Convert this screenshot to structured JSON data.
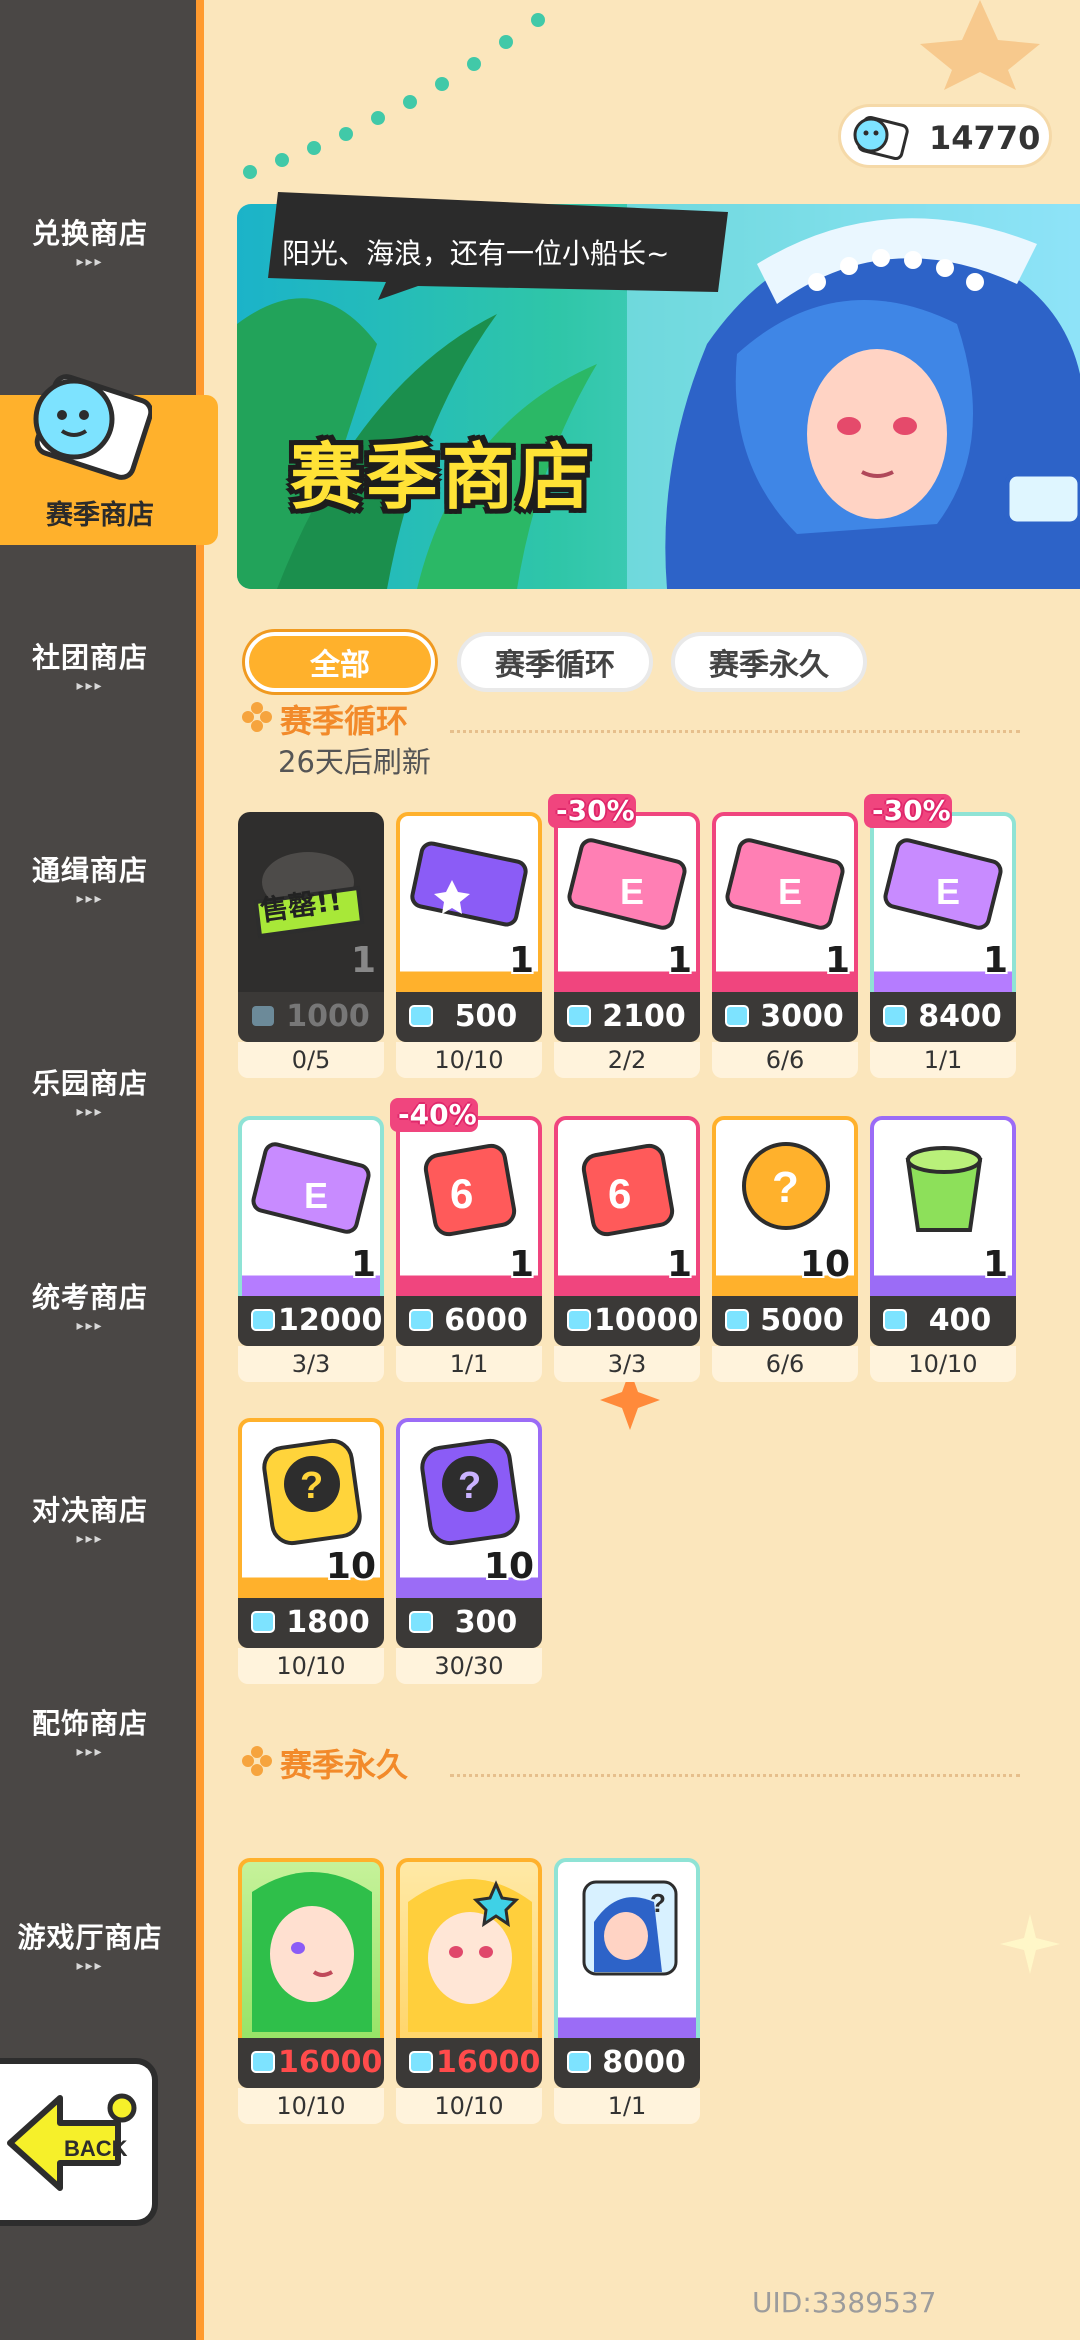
{
  "currency": {
    "amount": "14770",
    "icon": "season-ticket-icon"
  },
  "banner": {
    "speech": "阳光、海浪，还有一位小船长~",
    "title": "赛季商店"
  },
  "sidebar": {
    "items": [
      {
        "label": "兑换商店"
      },
      {
        "label": "赛季商店",
        "active": true
      },
      {
        "label": "社团商店"
      },
      {
        "label": "通缉商店"
      },
      {
        "label": "乐园商店"
      },
      {
        "label": "统考商店"
      },
      {
        "label": "对决商店"
      },
      {
        "label": "配饰商店"
      },
      {
        "label": "游戏厅商店"
      }
    ],
    "arrows": "▸▸▸",
    "back_label": "BACK"
  },
  "tabs": [
    {
      "label": "全部",
      "active": true
    },
    {
      "label": "赛季循环"
    },
    {
      "label": "赛季永久"
    }
  ],
  "sections": {
    "cycle": {
      "title": "赛季循环",
      "refresh": "26天后刷新"
    },
    "permanent": {
      "title": "赛季永久"
    }
  },
  "items": [
    {
      "price": "1000",
      "stock": "0/5",
      "count": "1",
      "sold_out": "售罄!!",
      "icon": "sold-out-item-icon"
    },
    {
      "price": "500",
      "stock": "10/10",
      "count": "1",
      "icon": "purple-ticket-icon"
    },
    {
      "price": "2100",
      "stock": "2/2",
      "count": "1",
      "discount": "-30%",
      "icon": "pink-card-icon"
    },
    {
      "price": "3000",
      "stock": "6/6",
      "count": "1",
      "icon": "pink-card-icon"
    },
    {
      "price": "8400",
      "stock": "1/1",
      "count": "1",
      "discount": "-30%",
      "icon": "rainbow-card-icon"
    },
    {
      "price": "12000",
      "stock": "3/3",
      "count": "1",
      "icon": "rainbow-card-icon"
    },
    {
      "price": "6000",
      "stock": "1/1",
      "count": "1",
      "discount": "-40%",
      "icon": "red-dice-icon"
    },
    {
      "price": "10000",
      "stock": "3/3",
      "count": "1",
      "icon": "red-dice-icon"
    },
    {
      "price": "5000",
      "stock": "6/6",
      "count": "10",
      "icon": "mystery-capsule-icon"
    },
    {
      "price": "400",
      "stock": "10/10",
      "count": "1",
      "icon": "green-jelly-icon"
    },
    {
      "price": "1800",
      "stock": "10/10",
      "count": "10",
      "icon": "gold-question-token-icon"
    },
    {
      "price": "300",
      "stock": "30/30",
      "count": "10",
      "icon": "purple-question-token-icon"
    }
  ],
  "permanent_items": [
    {
      "price": "16000",
      "stock": "10/10",
      "icon": "green-hair-character-icon"
    },
    {
      "price": "16000",
      "stock": "10/10",
      "icon": "blonde-character-icon"
    },
    {
      "price": "8000",
      "stock": "1/1",
      "icon": "blue-hair-avatar-icon"
    }
  ],
  "uid": "UID:3389537",
  "colors": {
    "accent": "#ffb12c",
    "sidebar": "#4a4745",
    "background": "#fbe6bc",
    "price_red": "#ff4b4b"
  }
}
